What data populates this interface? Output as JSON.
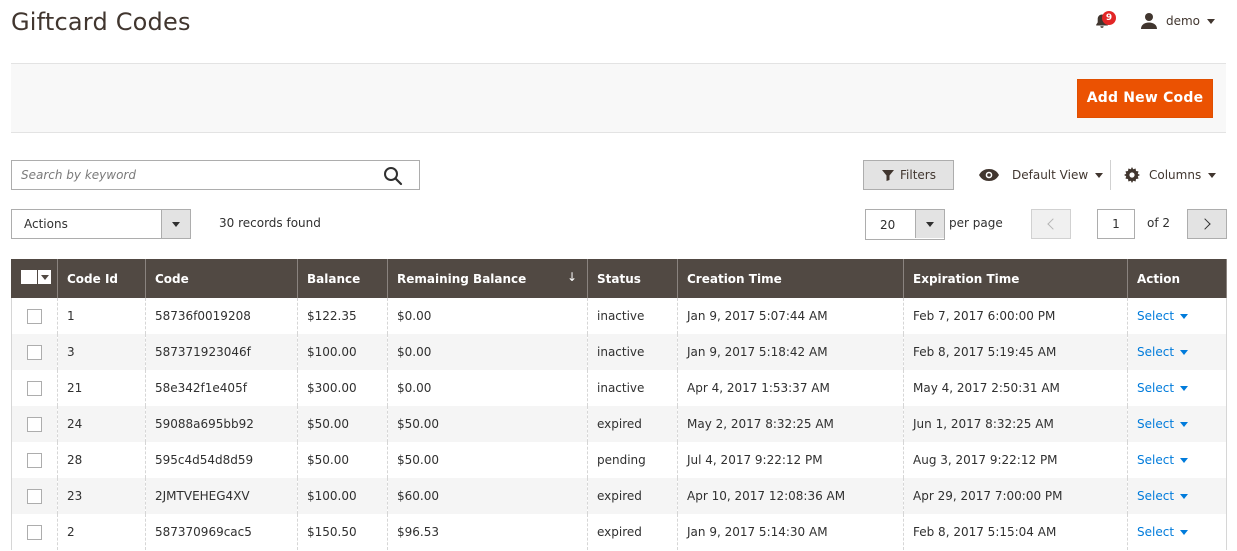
{
  "page": {
    "title": "Giftcard Codes"
  },
  "header": {
    "notifications_count": "9",
    "user_name": "demo"
  },
  "toolbar": {
    "add_label": "Add New Code"
  },
  "search": {
    "placeholder": "Search by keyword"
  },
  "controls": {
    "filters_label": "Filters",
    "view_label": "Default View",
    "columns_label": "Columns",
    "actions_label": "Actions",
    "records_found": "30 records found",
    "per_page_value": "20",
    "per_page_label": "per page",
    "current_page": "1",
    "of_pages": "of 2"
  },
  "table": {
    "columns": [
      "Code Id",
      "Code",
      "Balance",
      "Remaining Balance",
      "Status",
      "Creation Time",
      "Expiration Time",
      "Action"
    ],
    "sort_indicator": "↓",
    "action_label": "Select",
    "rows": [
      {
        "id": "1",
        "code": "58736f0019208",
        "balance": "$122.35",
        "remaining": "$0.00",
        "status": "inactive",
        "created": "Jan 9, 2017 5:07:44 AM",
        "expires": "Feb 7, 2017 6:00:00 PM"
      },
      {
        "id": "3",
        "code": "587371923046f",
        "balance": "$100.00",
        "remaining": "$0.00",
        "status": "inactive",
        "created": "Jan 9, 2017 5:18:42 AM",
        "expires": "Feb 8, 2017 5:19:45 AM"
      },
      {
        "id": "21",
        "code": "58e342f1e405f",
        "balance": "$300.00",
        "remaining": "$0.00",
        "status": "inactive",
        "created": "Apr 4, 2017 1:53:37 AM",
        "expires": "May 4, 2017 2:50:31 AM"
      },
      {
        "id": "24",
        "code": "59088a695bb92",
        "balance": "$50.00",
        "remaining": "$50.00",
        "status": "expired",
        "created": "May 2, 2017 8:32:25 AM",
        "expires": "Jun 1, 2017 8:32:25 AM"
      },
      {
        "id": "28",
        "code": "595c4d54d8d59",
        "balance": "$50.00",
        "remaining": "$50.00",
        "status": "pending",
        "created": "Jul 4, 2017 9:22:12 PM",
        "expires": "Aug 3, 2017 9:22:12 PM"
      },
      {
        "id": "23",
        "code": "2JMTVEHEG4XV",
        "balance": "$100.00",
        "remaining": "$60.00",
        "status": "expired",
        "created": "Apr 10, 2017 12:08:36 AM",
        "expires": "Apr 29, 2017 7:00:00 PM"
      },
      {
        "id": "2",
        "code": "587370969cac5",
        "balance": "$150.50",
        "remaining": "$96.53",
        "status": "expired",
        "created": "Jan 9, 2017 5:14:30 AM",
        "expires": "Feb 8, 2017 5:15:04 AM"
      }
    ]
  },
  "colors": {
    "accent": "#eb5202",
    "header_bg": "#514943",
    "link": "#007bdb",
    "badge": "#e22626"
  }
}
